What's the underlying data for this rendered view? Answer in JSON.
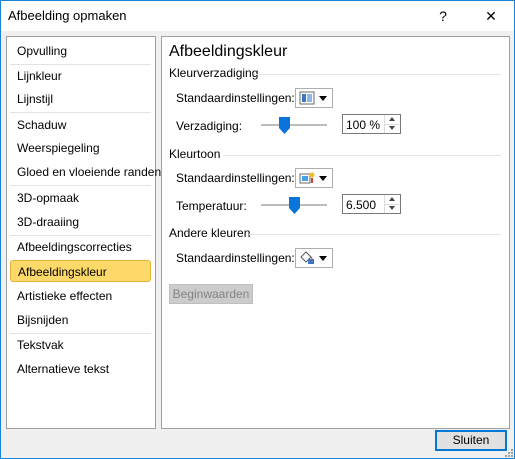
{
  "window": {
    "title": "Afbeelding opmaken",
    "help": "?",
    "close": "✕"
  },
  "nav": {
    "items": [
      "Opvulling",
      "Lijnkleur",
      "Lijnstijl",
      "Schaduw",
      "Weerspiegeling",
      "Gloed en vloeiende randen",
      "3D-opmaak",
      "3D-draaiing",
      "Afbeeldingscorrecties",
      "Afbeeldingskleur",
      "Artistieke effecten",
      "Bijsnijden",
      "Tekstvak",
      "Alternatieve tekst"
    ],
    "selected": "Afbeeldingskleur"
  },
  "panel": {
    "title": "Afbeeldingskleur",
    "saturation": {
      "heading": "Kleurverzadiging",
      "preset_label": "Standaardinstellingen:",
      "value_label": "Verzadiging:",
      "value": "100 %",
      "slider_fraction": 0.33
    },
    "tone": {
      "heading": "Kleurtoon",
      "preset_label": "Standaardinstellingen:",
      "value_label": "Temperatuur:",
      "value": "6.500",
      "slider_fraction": 0.5
    },
    "recolor": {
      "heading": "Andere kleuren",
      "preset_label": "Standaardinstellingen:"
    },
    "reset_button": "Beginwaarden"
  },
  "footer": {
    "close_button": "Sluiten"
  },
  "colors": {
    "accent": "#0078d7",
    "selected_bg": "#fdd96a",
    "selected_border": "#e5b33a"
  }
}
